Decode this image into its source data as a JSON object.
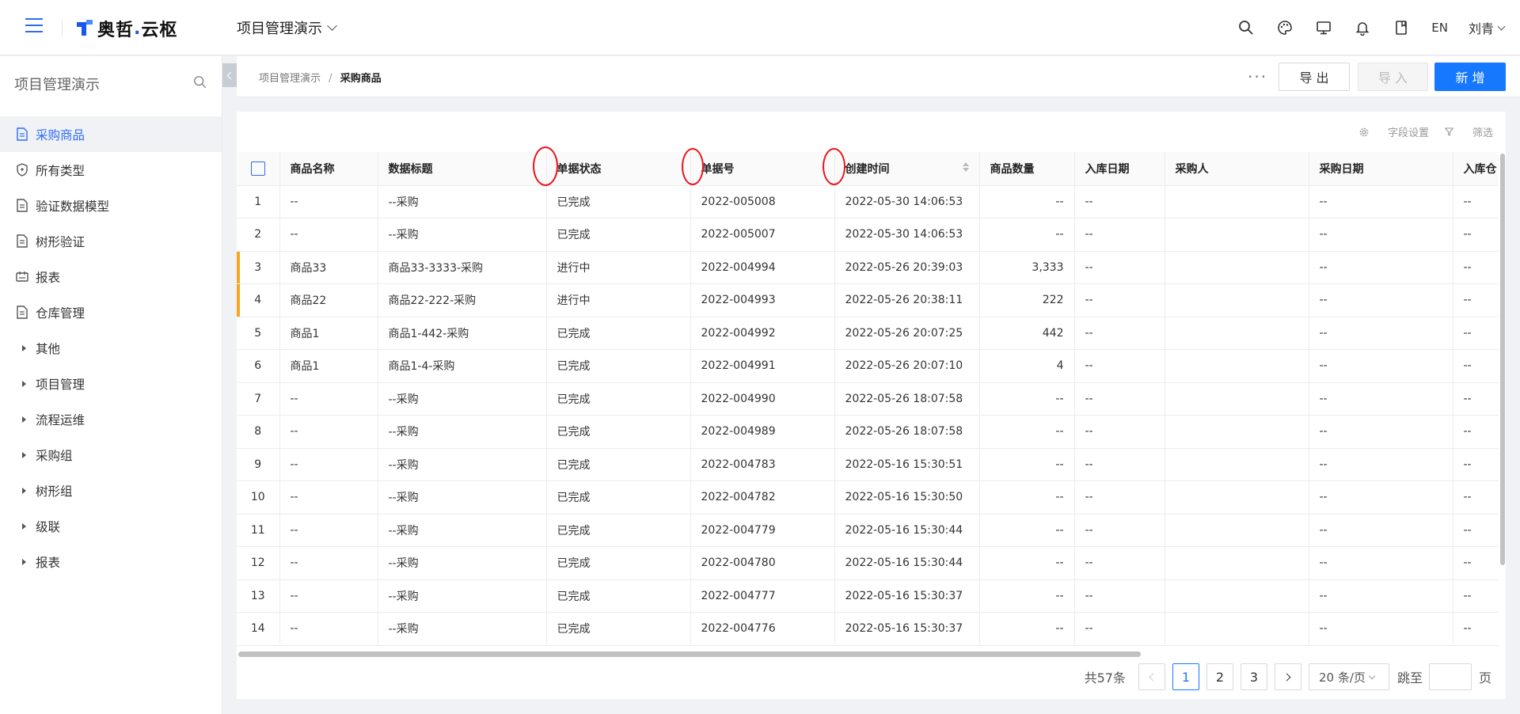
{
  "header": {
    "logo_text": "奥哲",
    "logo_sub": "云枢",
    "project_name": "项目管理演示",
    "icons": [
      "search-icon",
      "palette-icon",
      "monitor-icon",
      "bell-icon",
      "book-icon"
    ],
    "lang": "EN",
    "user_name": "刘青"
  },
  "sidebar": {
    "title": "项目管理演示",
    "items": [
      {
        "label": "采购商品",
        "icon": "document-icon",
        "active": true
      },
      {
        "label": "所有类型",
        "icon": "shield-icon"
      },
      {
        "label": "验证数据模型",
        "icon": "document-icon"
      },
      {
        "label": "树形验证",
        "icon": "document-icon"
      },
      {
        "label": "报表",
        "icon": "report-icon"
      },
      {
        "label": "仓库管理",
        "icon": "document-icon"
      }
    ],
    "groups": [
      "其他",
      "项目管理",
      "流程运维",
      "采购组",
      "树形组",
      "级联",
      "报表"
    ]
  },
  "breadcrumb": {
    "root": "项目管理演示",
    "sep": "/",
    "current": "采购商品"
  },
  "actions": {
    "more": "···",
    "export": "导 出",
    "import": "导 入",
    "new": "新 增"
  },
  "table_tools": {
    "field_settings": "字段设置",
    "filter": "筛选"
  },
  "table": {
    "columns": [
      "商品名称",
      "数据标题",
      "单据状态",
      "单据号",
      "创建时间",
      "商品数量",
      "入库日期",
      "采购人",
      "采购日期",
      "入库仓"
    ],
    "rows": [
      {
        "idx": "1",
        "name": "--",
        "title": "--采购",
        "status": "已完成",
        "no": "2022-005008",
        "created": "2022-05-30 14:06:53",
        "qty": "--",
        "in_date": "--",
        "buyer": "",
        "buy_date": "--",
        "warehouse": "--",
        "mark": false
      },
      {
        "idx": "2",
        "name": "--",
        "title": "--采购",
        "status": "已完成",
        "no": "2022-005007",
        "created": "2022-05-30 14:06:53",
        "qty": "--",
        "in_date": "--",
        "buyer": "",
        "buy_date": "--",
        "warehouse": "--",
        "mark": false
      },
      {
        "idx": "3",
        "name": "商品33",
        "title": "商品33-3333-采购",
        "status": "进行中",
        "no": "2022-004994",
        "created": "2022-05-26 20:39:03",
        "qty": "3,333",
        "in_date": "--",
        "buyer": "",
        "buy_date": "--",
        "warehouse": "--",
        "mark": true
      },
      {
        "idx": "4",
        "name": "商品22",
        "title": "商品22-222-采购",
        "status": "进行中",
        "no": "2022-004993",
        "created": "2022-05-26 20:38:11",
        "qty": "222",
        "in_date": "--",
        "buyer": "",
        "buy_date": "--",
        "warehouse": "--",
        "mark": true
      },
      {
        "idx": "5",
        "name": "商品1",
        "title": "商品1-442-采购",
        "status": "已完成",
        "no": "2022-004992",
        "created": "2022-05-26 20:07:25",
        "qty": "442",
        "in_date": "--",
        "buyer": "",
        "buy_date": "--",
        "warehouse": "--",
        "mark": false
      },
      {
        "idx": "6",
        "name": "商品1",
        "title": "商品1-4-采购",
        "status": "已完成",
        "no": "2022-004991",
        "created": "2022-05-26 20:07:10",
        "qty": "4",
        "in_date": "--",
        "buyer": "",
        "buy_date": "--",
        "warehouse": "--",
        "mark": false
      },
      {
        "idx": "7",
        "name": "--",
        "title": "--采购",
        "status": "已完成",
        "no": "2022-004990",
        "created": "2022-05-26 18:07:58",
        "qty": "--",
        "in_date": "--",
        "buyer": "",
        "buy_date": "--",
        "warehouse": "--",
        "mark": false
      },
      {
        "idx": "8",
        "name": "--",
        "title": "--采购",
        "status": "已完成",
        "no": "2022-004989",
        "created": "2022-05-26 18:07:58",
        "qty": "--",
        "in_date": "--",
        "buyer": "",
        "buy_date": "--",
        "warehouse": "--",
        "mark": false
      },
      {
        "idx": "9",
        "name": "--",
        "title": "--采购",
        "status": "已完成",
        "no": "2022-004783",
        "created": "2022-05-16 15:30:51",
        "qty": "--",
        "in_date": "--",
        "buyer": "",
        "buy_date": "--",
        "warehouse": "--",
        "mark": false
      },
      {
        "idx": "10",
        "name": "--",
        "title": "--采购",
        "status": "已完成",
        "no": "2022-004782",
        "created": "2022-05-16 15:30:50",
        "qty": "--",
        "in_date": "--",
        "buyer": "",
        "buy_date": "--",
        "warehouse": "--",
        "mark": false
      },
      {
        "idx": "11",
        "name": "--",
        "title": "--采购",
        "status": "已完成",
        "no": "2022-004779",
        "created": "2022-05-16 15:30:44",
        "qty": "--",
        "in_date": "--",
        "buyer": "",
        "buy_date": "--",
        "warehouse": "--",
        "mark": false
      },
      {
        "idx": "12",
        "name": "--",
        "title": "--采购",
        "status": "已完成",
        "no": "2022-004780",
        "created": "2022-05-16 15:30:44",
        "qty": "--",
        "in_date": "--",
        "buyer": "",
        "buy_date": "--",
        "warehouse": "--",
        "mark": false
      },
      {
        "idx": "13",
        "name": "--",
        "title": "--采购",
        "status": "已完成",
        "no": "2022-004777",
        "created": "2022-05-16 15:30:37",
        "qty": "--",
        "in_date": "--",
        "buyer": "",
        "buy_date": "--",
        "warehouse": "--",
        "mark": false
      },
      {
        "idx": "14",
        "name": "--",
        "title": "--采购",
        "status": "已完成",
        "no": "2022-004776",
        "created": "2022-05-16 15:30:37",
        "qty": "--",
        "in_date": "--",
        "buyer": "",
        "buy_date": "--",
        "warehouse": "--",
        "mark": false
      }
    ]
  },
  "pagination": {
    "total": "共57条",
    "pages": [
      "1",
      "2",
      "3"
    ],
    "current": "1",
    "page_size": "20 条/页",
    "jump_label": "跳至",
    "jump_suffix": "页"
  },
  "colors": {
    "primary": "#1677ff",
    "annotation": "#e8141b",
    "row_mark": "#f5a623"
  }
}
